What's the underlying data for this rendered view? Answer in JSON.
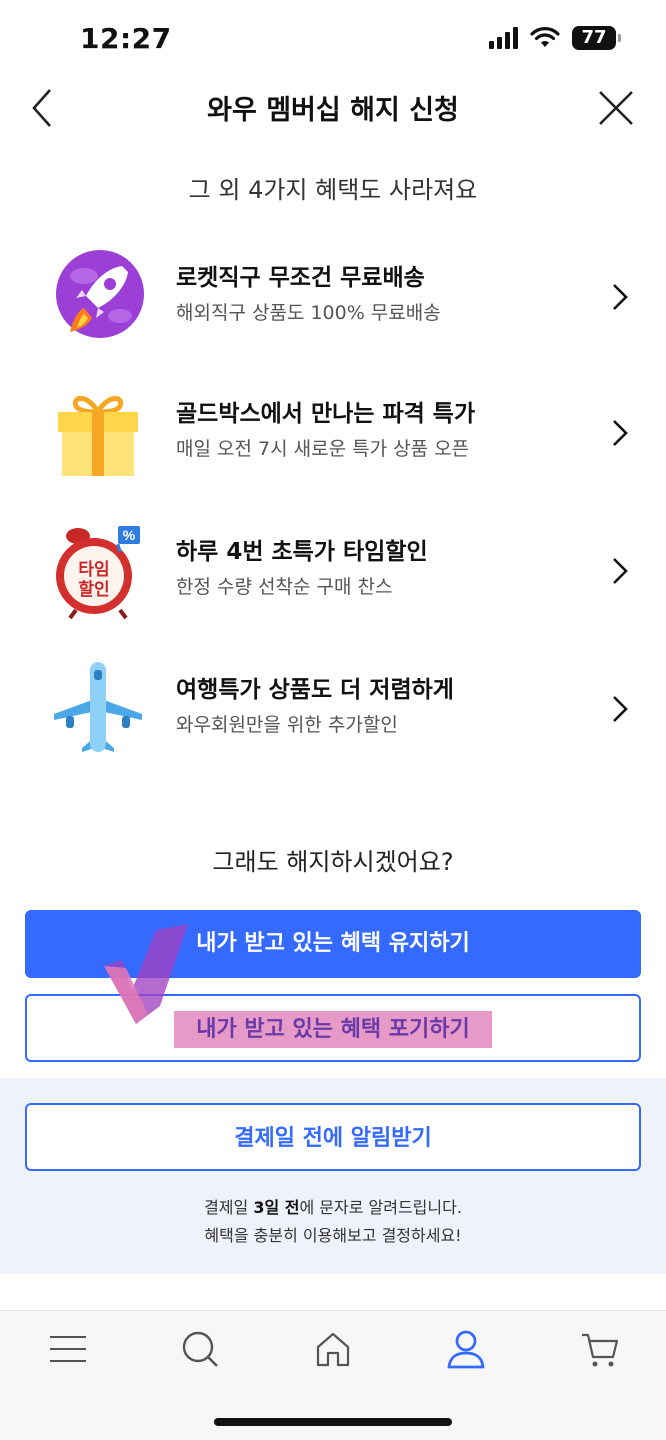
{
  "status_bar": {
    "time": "12:27",
    "battery": "77"
  },
  "header": {
    "title": "와우 멤버십 해지 신청"
  },
  "section_subtitle": "그 외 4가지 혜택도 사라져요",
  "benefits": [
    {
      "title": "로켓직구 무조건 무료배송",
      "description": "해외직구 상품도 100% 무료배송",
      "icon": "rocket-icon"
    },
    {
      "title": "골드박스에서 만나는 파격 특가",
      "description": "매일 오전 7시 새로운 특가 상품 오픈",
      "icon": "gift-box-icon"
    },
    {
      "title": "하루 4번 초특가 타임할인",
      "description": "한정 수량 선착순 구매 찬스",
      "icon": "alarm-clock-icon",
      "icon_text_1": "타임",
      "icon_text_2": "할인",
      "icon_badge": "%"
    },
    {
      "title": "여행특가 상품도 더 저렴하게",
      "description": "와우회원만을 위한 추가할인",
      "icon": "airplane-icon"
    }
  ],
  "question": "그래도 해지하시겠어요?",
  "buttons": {
    "keep": "내가 받고 있는 혜택 유지하기",
    "give_up": "내가 받고 있는 혜택 포기하기",
    "notify": "결제일 전에 알림받기"
  },
  "notice": {
    "line1_prefix": "결제일 ",
    "line1_bold": "3일 전",
    "line1_suffix": "에 문자로 알려드립니다.",
    "line2": "혜택을 충분히 이용해보고 결정하세요!"
  },
  "bottom_nav": [
    "menu-icon",
    "search-icon",
    "home-icon",
    "my-page-icon",
    "cart-icon"
  ],
  "colors": {
    "primary": "#346aff",
    "highlight": "#e79ac8",
    "panel_bg": "#eef2fb"
  }
}
